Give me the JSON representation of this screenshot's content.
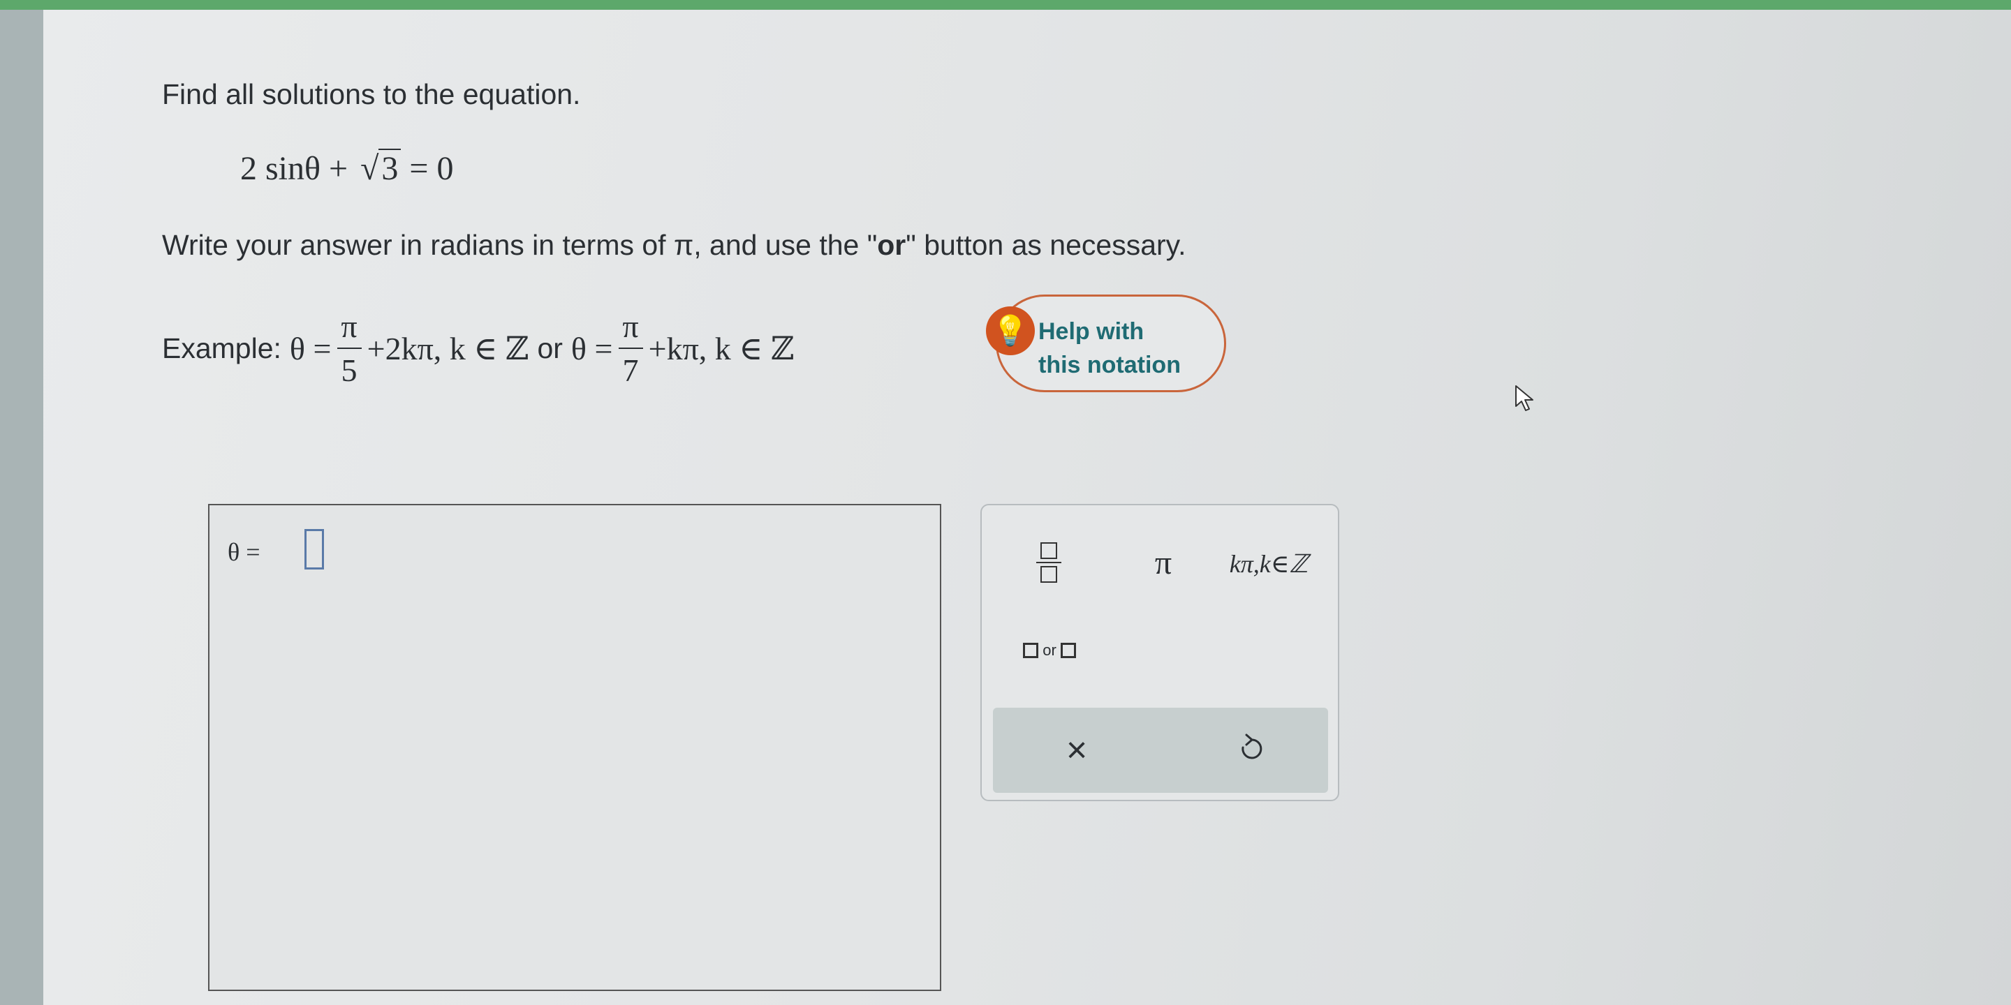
{
  "question": {
    "prompt": "Find all solutions to the equation.",
    "equation": {
      "left": "2 sinθ +",
      "radicand": "3",
      "right": "= 0"
    },
    "instruction": {
      "before": "Write your answer in radians in terms of π, and use the \"",
      "bold": "or",
      "after": "\" button as necessary."
    },
    "example": {
      "label": "Example:",
      "lhs1": "θ =",
      "num1": "π",
      "den1": "5",
      "term1": "+2kπ, k ∈ ℤ",
      "connector": "or",
      "lhs2": "θ =",
      "num2": "π",
      "den2": "7",
      "term2": "+kπ, k ∈ ℤ"
    }
  },
  "help_button": {
    "line1": "Help with",
    "line2": "this notation",
    "icon": "lightbulb-icon"
  },
  "answer": {
    "variable_label": "θ =",
    "value": ""
  },
  "keypad": {
    "pi_label": "π",
    "kpi_label": "kπ,k∈ℤ",
    "or_label": "or",
    "clear_label": "×",
    "icons": [
      "fraction-icon",
      "or-template-icon",
      "undo-icon"
    ]
  },
  "colors": {
    "accent_orange": "#d1531f",
    "help_text_teal": "#1f6b73",
    "top_bar_green": "#5da86b",
    "input_blue": "#5a7aa8"
  }
}
